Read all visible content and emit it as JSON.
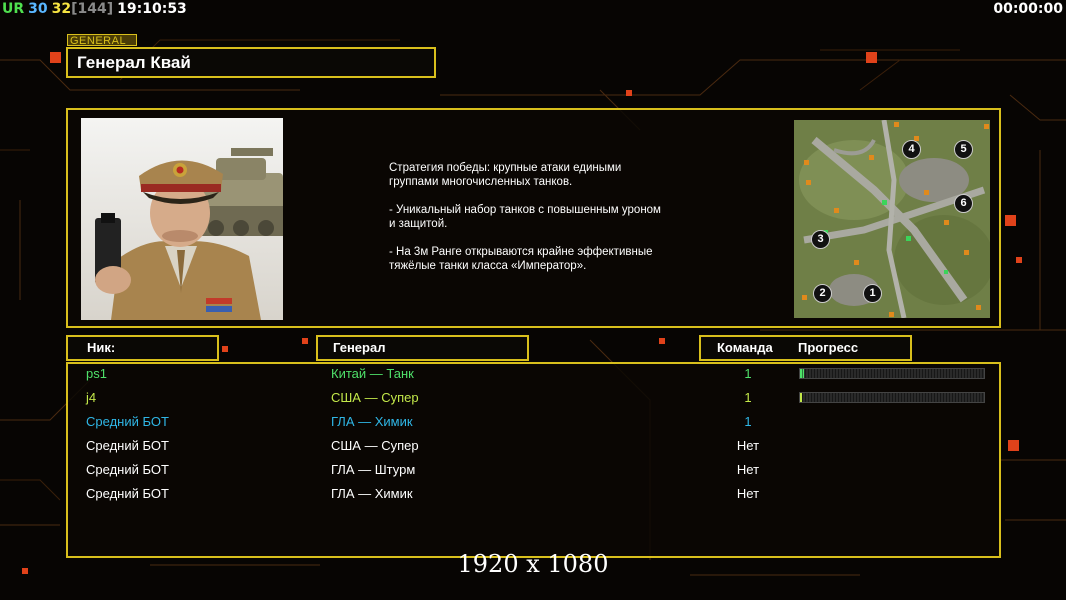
{
  "hud": {
    "ur": "UR",
    "fps": "30",
    "count": "32",
    "count_bracket": "[144]",
    "clock": "19:10:53",
    "timer": "00:00:00"
  },
  "general": {
    "tag": "GENERAL",
    "name": "Генерал Квай",
    "description": "Стратегия победы: крупные атаки едиными\n группами многочисленных танков.\n\n- Уникальный набор танков с повышенным уроном\n и защитой.\n\n- На 3м Ранге открываются крайне эффективные\n тяжёлые танки класса «Император»."
  },
  "minimap": {
    "start_positions": [
      "1",
      "2",
      "3",
      "4",
      "5",
      "6"
    ]
  },
  "table": {
    "headers": {
      "nick": "Ник:",
      "general": "Генерал",
      "team": "Команда",
      "progress": "Прогресс"
    },
    "rows": [
      {
        "nick": "ps1",
        "general": "Китай — Танк",
        "team": "1",
        "color": "#4fe06a",
        "progress": 0.02
      },
      {
        "nick": "j4",
        "general": "США — Супер",
        "team": "1",
        "color": "#c3e84a",
        "progress": 0.01
      },
      {
        "nick": "Средний БОТ",
        "general": "ГЛА — Химик",
        "team": "1",
        "color": "#2fb6e6"
      },
      {
        "nick": "Средний БОТ",
        "general": "США — Супер",
        "team": "Нет",
        "color": "#ffffff"
      },
      {
        "nick": "Средний БОТ",
        "general": "ГЛА — Штурм",
        "team": "Нет",
        "color": "#ffffff"
      },
      {
        "nick": "Средний БОТ",
        "general": "ГЛА — Химик",
        "team": "Нет",
        "color": "#ffffff"
      }
    ]
  },
  "resolution": "1920 x 1080",
  "colors": {
    "frame": "#d8bf1c",
    "accent_square": "#e0421a"
  }
}
